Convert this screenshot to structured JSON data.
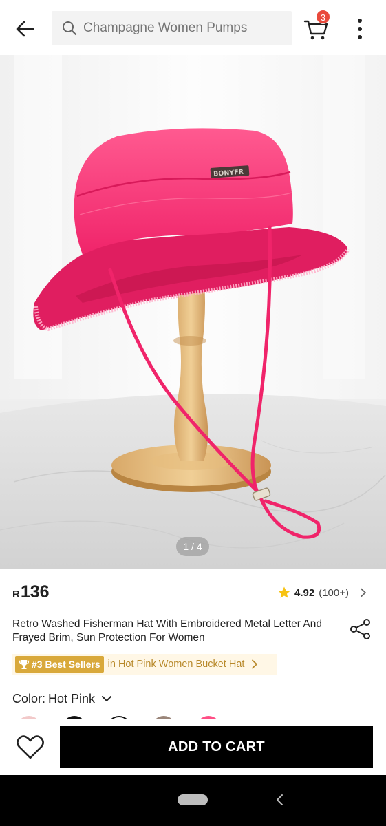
{
  "header": {
    "search_placeholder": "Champagne Women Pumps",
    "cart_count": "3"
  },
  "gallery": {
    "pager": "1 / 4",
    "hat_logo": "BONYFR"
  },
  "product": {
    "currency": "R",
    "price": "136",
    "rating": "4.92",
    "rating_count": "(100+)",
    "title": "Retro Washed Fisherman Hat With Embroidered Metal Letter And Frayed Brim, Sun Protection For Women",
    "bestseller_badge": "#3 Best Sellers",
    "bestseller_text": "in Hot Pink Women Bucket Hat",
    "color_label": "Color:",
    "color_value": "Hot Pink"
  },
  "swatches": [
    {
      "color": "#f2c9c9"
    },
    {
      "color": "#111111"
    },
    {
      "color": "#ffffff"
    },
    {
      "color": "#9a8579"
    },
    {
      "color": "#ff4f86"
    }
  ],
  "action_bar": {
    "add_to_cart": "ADD TO CART"
  },
  "colors": {
    "accent_pink": "#ff2f7a",
    "badge_red": "#e94a3c",
    "bestseller_gold": "#d9a93b"
  }
}
